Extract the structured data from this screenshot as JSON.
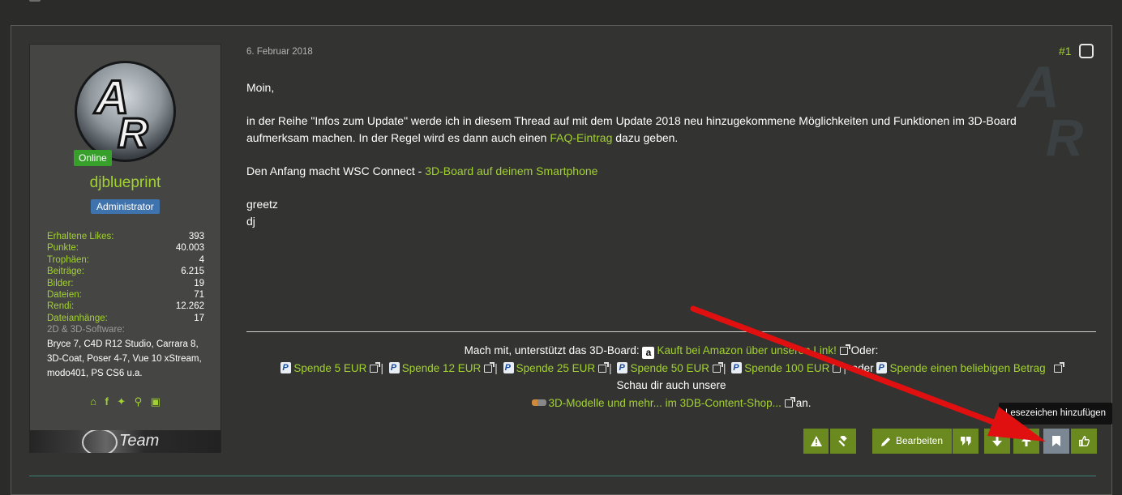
{
  "post": {
    "date": "6. Februar 2018",
    "number": "#1",
    "author": {
      "online_badge": "Online",
      "name": "djblueprint",
      "role": "Administrator",
      "stats": [
        {
          "label": "Erhaltene Likes:",
          "value": "393"
        },
        {
          "label": "Punkte:",
          "value": "40.003"
        },
        {
          "label": "Trophäen:",
          "value": "4"
        },
        {
          "label": "Beiträge:",
          "value": "6.215"
        },
        {
          "label": "Bilder:",
          "value": "19"
        },
        {
          "label": "Dateien:",
          "value": "71"
        },
        {
          "label": "Rendi:",
          "value": "12.262"
        },
        {
          "label": "Dateianhänge:",
          "value": "17"
        }
      ],
      "software_label": "2D & 3D-Software:",
      "software_value": "Bryce 7, C4D R12 Studio, Carrara 8, 3D-Coat, Poser 4-7, Vue 10 xStream, modo401, PS CS6 u.a.",
      "team_banner": "Team"
    },
    "body": {
      "greeting": "Moin,",
      "p1_part1": "in der Reihe \"Infos zum Update\" werde ich in diesem Thread auf mit dem Update 2018 neu hinzugekommene Möglichkeiten und Funktionen im 3D-Board aufmerksam machen. In der Regel wird es dann auch einen ",
      "p1_link": "FAQ-Eintrag",
      "p1_part2": " dazu geben.",
      "p2_text": "Den Anfang macht WSC Connect - ",
      "p2_link": "3D-Board auf deinem Smartphone",
      "closing1": "greetz",
      "closing2": "dj"
    },
    "signature": {
      "line1_text": "Mach mit, unterstützt das 3D-Board:",
      "line1_link": "Kauft bei Amazon über unseren Link!",
      "line1_after": "Oder:",
      "donations": [
        "Spende 5 EUR",
        "Spende 12 EUR",
        "Spende 25 EUR",
        "Spende 50 EUR",
        "Spende 100 EUR"
      ],
      "oder": "oder",
      "donation_any": "Spende einen beliebigen Betrag",
      "line3": "Schau dir auch unsere",
      "shop_link": "3D-Modelle und mehr... im 3DB-Content-Shop...",
      "shop_after": "an."
    },
    "actions": {
      "edit_label": "Bearbeiten",
      "tooltip": "Lesezeichen hinzufügen"
    }
  },
  "colors": {
    "accent": "#a2d22f",
    "button_green": "#6a8a1f",
    "arrow_red": "#e01010"
  }
}
